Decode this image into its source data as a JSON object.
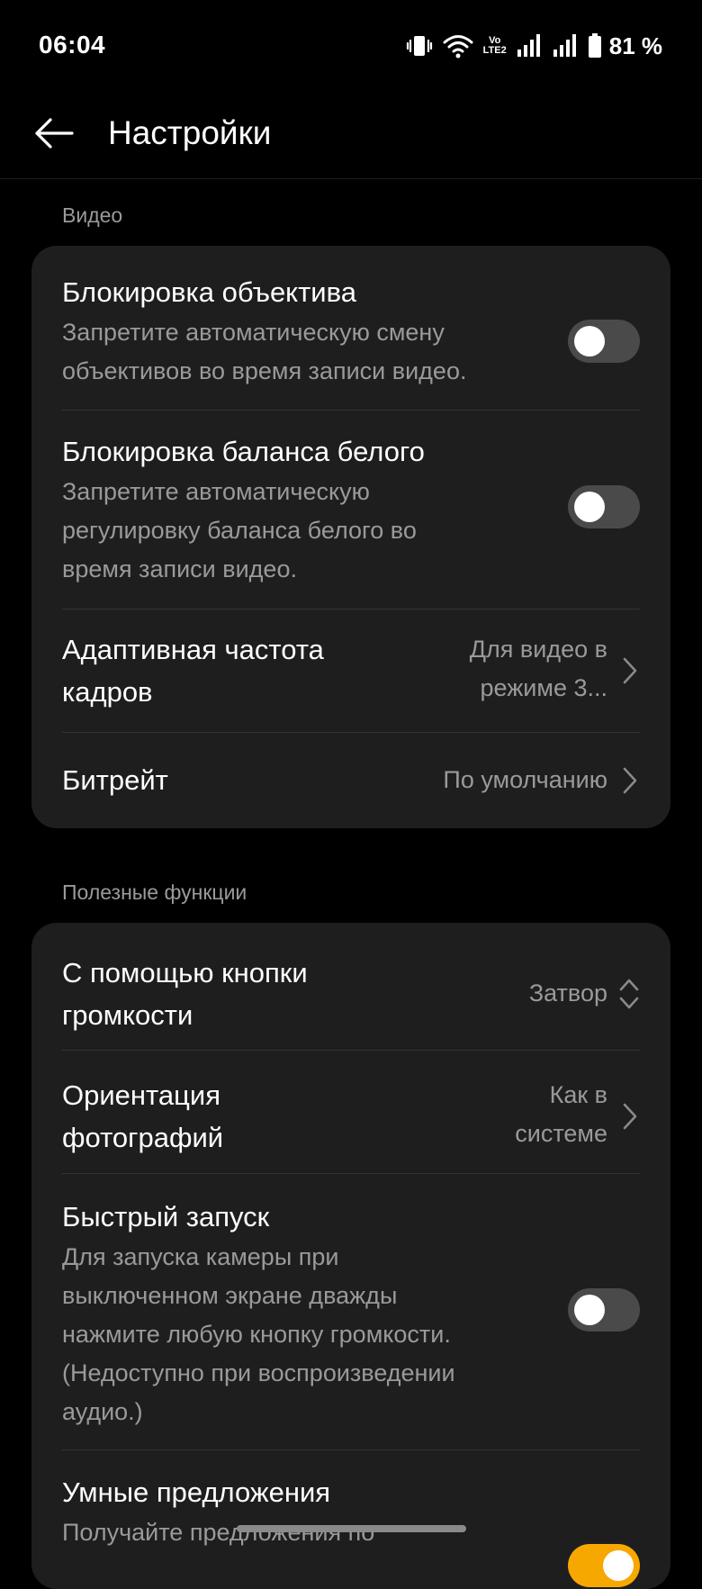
{
  "status_bar": {
    "time": "06:04",
    "volte_top": "Vo",
    "volte_bottom": "LTE2",
    "battery": "81 %"
  },
  "header": {
    "title": "Настройки"
  },
  "sections": {
    "video": {
      "label": "Видео",
      "lens_lock": {
        "title": "Блокировка объектива",
        "desc_1": "Запретите автоматическую смену",
        "desc_2": "объективов во время записи видео.",
        "enabled": false
      },
      "wb_lock": {
        "title": "Блокировка баланса белого",
        "desc_1": "Запретите автоматическую",
        "desc_2": "регулировку баланса белого во",
        "desc_3": "время записи видео.",
        "enabled": false
      },
      "adaptive_fps": {
        "title_1": "Адаптивная частота",
        "title_2": "кадров",
        "value_1": "Для видео в",
        "value_2": "режиме 3..."
      },
      "bitrate": {
        "title": "Битрейт",
        "value": "По умолчанию"
      }
    },
    "useful": {
      "label": "Полезные функции",
      "volume_button": {
        "title_1": "С помощью кнопки",
        "title_2": "громкости",
        "value": "Затвор"
      },
      "photo_orientation": {
        "title_1": "Ориентация",
        "title_2": "фотографий",
        "value_1": "Как в",
        "value_2": "системе"
      },
      "quick_launch": {
        "title": "Быстрый запуск",
        "desc_1": "Для запуска камеры при",
        "desc_2": "выключенном экране дважды",
        "desc_3": "нажмите любую кнопку громкости.",
        "desc_4": "(Недоступно при воспроизведении",
        "desc_5": "аудио.)",
        "enabled": false
      },
      "smart_suggestions": {
        "title": "Умные предложения",
        "desc_1": "Получайте предложения по",
        "enabled": true
      }
    }
  },
  "colors": {
    "background": "#000000",
    "card": "#1e1e1e",
    "secondary_text": "#9a9a9a",
    "toggle_off": "#4a4a4a",
    "toggle_on": "#f7a800"
  }
}
